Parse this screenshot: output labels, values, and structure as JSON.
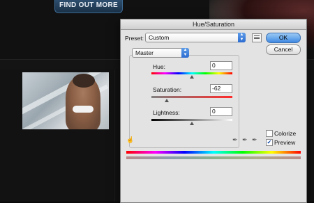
{
  "page": {
    "find_out_more": "FIND OUT MORE"
  },
  "dialog": {
    "title": "Hue/Saturation",
    "preset_label": "Preset:",
    "preset_value": "Custom",
    "channel_value": "Master",
    "ok": "OK",
    "cancel": "Cancel",
    "hue": {
      "label": "Hue:",
      "value": "0",
      "position": 0.5
    },
    "saturation": {
      "label": "Saturation:",
      "value": "-62",
      "position": 0.19
    },
    "lightness": {
      "label": "Lightness:",
      "value": "0",
      "position": 0.5
    },
    "colorize": {
      "label": "Colorize",
      "checked": false
    },
    "preview": {
      "label": "Preview",
      "checked": true
    },
    "icons": [
      "hand-adjust-icon",
      "eyedropper-icon",
      "eyedropper-plus-icon",
      "eyedropper-minus-icon"
    ],
    "hue_gradient": "#ff0000,#ff00ff,#0000ff,#00ffff,#00ff00,#ffff00,#ff0000",
    "saturation_gradient": "#808080,#ff2a2a",
    "lightness_gradient": "#000000,#808080,#ffffff"
  }
}
